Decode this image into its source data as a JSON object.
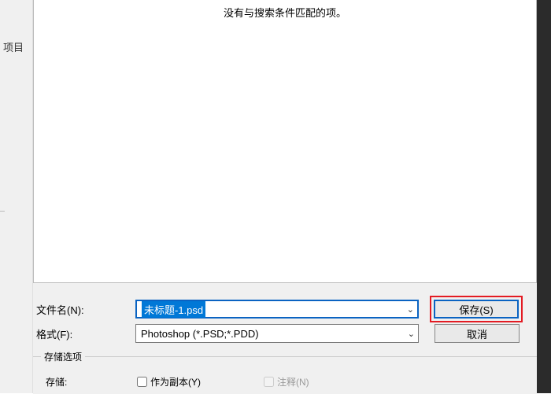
{
  "left_panel": {
    "label": "项目"
  },
  "file_list": {
    "empty_message": "没有与搜索条件匹配的项。"
  },
  "filename_row": {
    "label": "文件名(N):",
    "value": "未标题-1.psd"
  },
  "format_row": {
    "label": "格式(F):",
    "value": "Photoshop (*.PSD;*.PDD)"
  },
  "buttons": {
    "save": "保存(S)",
    "cancel": "取消"
  },
  "storage": {
    "legend": "存储选项",
    "label": "存储:",
    "as_copy": "作为副本(Y)",
    "annotations": "注释(N)"
  }
}
